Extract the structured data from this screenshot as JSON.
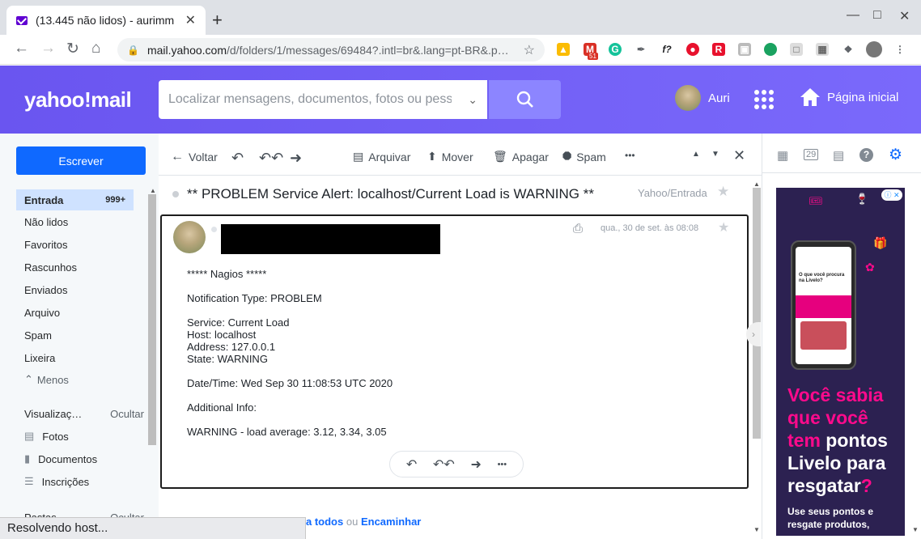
{
  "browser": {
    "tab_title": "(13.445 não lidos) - aurimm",
    "tab_close": "✕",
    "new_tab": "+",
    "url_host": "mail.yahoo.com",
    "url_path": "/d/folders/1/messages/69484?.intl=br&.lang=pt-BR&.p…",
    "gmail_badge": "51",
    "status_text": "Resolvendo host..."
  },
  "header": {
    "logo": "yahoo!mail",
    "search_placeholder": "Localizar mensagens, documentos, fotos ou pessoas",
    "user_name": "Auri",
    "home_label": "Página inicial"
  },
  "sidebar": {
    "compose_label": "Escrever",
    "folders": [
      {
        "label": "Entrada",
        "count": "999+"
      },
      {
        "label": "Não lidos"
      },
      {
        "label": "Favoritos"
      },
      {
        "label": "Rascunhos"
      },
      {
        "label": "Enviados"
      },
      {
        "label": "Arquivo"
      },
      {
        "label": "Spam"
      },
      {
        "label": "Lixeira"
      }
    ],
    "less_label": "Menos",
    "views_label": "Visualizaç…",
    "hide_label": "Ocultar",
    "views": [
      {
        "label": "Fotos"
      },
      {
        "label": "Documentos"
      },
      {
        "label": "Inscrições"
      }
    ],
    "folders_label": "Pastas",
    "hide_label2": "Ocultar"
  },
  "toolbar": {
    "back": "Voltar",
    "archive": "Arquivar",
    "move": "Mover",
    "delete": "Apagar",
    "spam": "Spam",
    "more": "•••"
  },
  "message": {
    "subject": "** PROBLEM Service Alert: localhost/Current Load is WARNING **",
    "folder": "Yahoo/Entrada",
    "date": "qua., 30 de set. às 08:08",
    "body": [
      "***** Nagios *****",
      "",
      "Notification Type: PROBLEM",
      "",
      "Service: Current Load",
      "Host: localhost",
      "Address: 127.0.0.1",
      "State: WARNING",
      "",
      "Date/Time: Wed Sep 30 11:08:53 UTC 2020",
      "",
      "Additional Info:",
      "",
      "WARNING - load average: 3.12, 3.34, 3.05"
    ],
    "reply_all": "a todos",
    "or": "ou",
    "forward": "Encaminhar"
  },
  "right_rail": {
    "calendar_day": "29"
  },
  "ad": {
    "phone_title": "O que você procura na Livelo?",
    "headline_pink1": "Você sabia que você tem",
    "headline_white": "pontos Livelo para resgatar",
    "question": "?",
    "sub": "Use seus pontos e resgate produtos,"
  },
  "colors": {
    "yahoo_purple": "#6b5bf6",
    "compose_blue": "#0f69ff",
    "ad_pink": "#ff0a8c",
    "ad_bg": "#2c2151"
  }
}
